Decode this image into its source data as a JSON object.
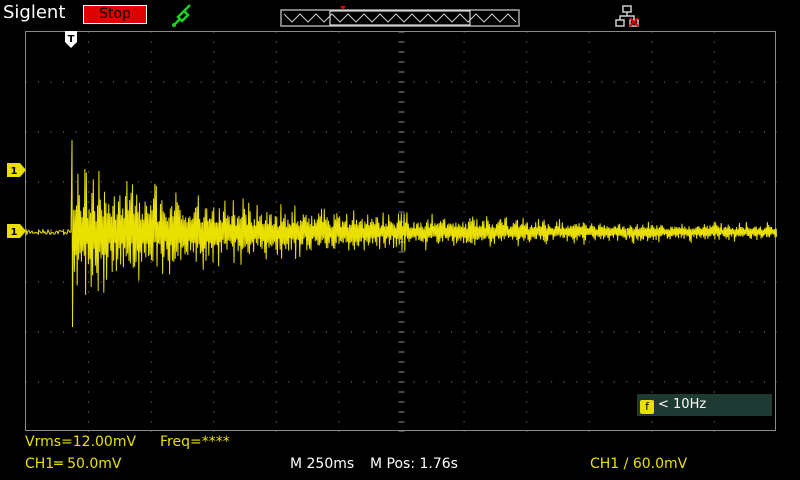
{
  "header": {
    "brand": "Siglent",
    "run_state": "Stop",
    "run_state_color": "#e00000",
    "icons": [
      "probe-icon",
      "timebase-overview-icon",
      "network-icon"
    ]
  },
  "screen": {
    "trigger_position_marker": "T",
    "channel_marker": "1",
    "trace_color": "#e9e000",
    "grid_color": "#8a8a8a"
  },
  "freq_counter": {
    "icon": "f",
    "text": "< 10Hz"
  },
  "measurements": {
    "vrms": "Vrms=12.00mV",
    "freq": "Freq=****"
  },
  "status_bar": {
    "ch1_scale": "CH1═ 50.0mV",
    "timebase": "M 250ms",
    "mpos": "M Pos: 1.76s",
    "trigger": "CH1 ∕ 60.0mV"
  }
}
